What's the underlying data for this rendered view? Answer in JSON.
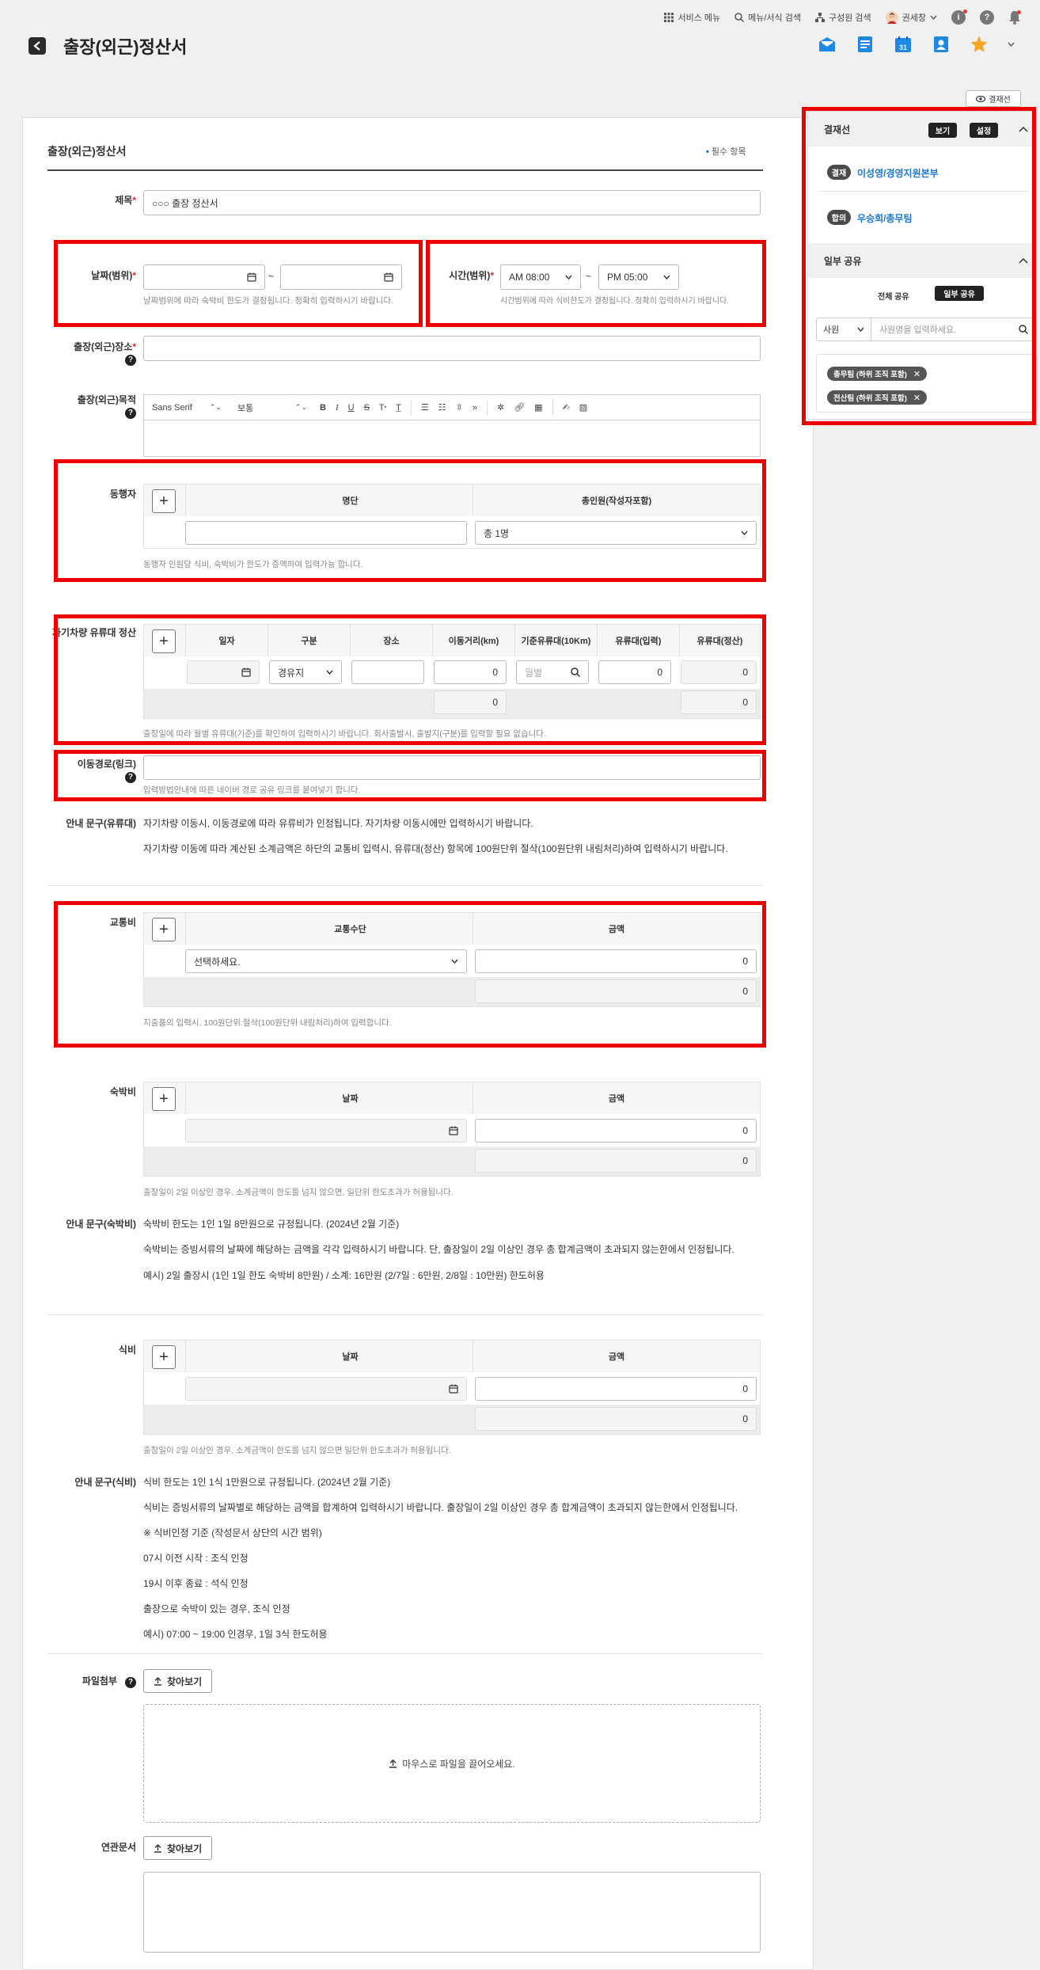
{
  "topnav": {
    "service_menu": "서비스 메뉴",
    "menu_search": "메뉴/서식 검색",
    "member_search": "구성원 검색",
    "user_name": "권세창"
  },
  "page": {
    "title": "출장(외근)정산서"
  },
  "approval_line_button": "결재선",
  "form": {
    "title": "출장(외근)정산서",
    "required_note": "필수 항목",
    "subject": {
      "label": "제목",
      "value": "○○○ 출장 정산서"
    },
    "date_range": {
      "label": "날짜(범위)",
      "separator": "~",
      "help": "날짜범위에 따라 숙박비 한도가 결정됩니다. 정확히 입력하시기 바랍니다."
    },
    "time_range": {
      "label": "시간(범위)",
      "start": "AM 08:00",
      "end": "PM 05:00",
      "separator": "~",
      "help": "시간범위에 따라 식비한도가 결정됩니다. 정확히 입력하시기 바랍니다."
    },
    "place": {
      "label": "출장(외근)장소"
    },
    "purpose": {
      "label": "출장(외근)목적",
      "toolbar_font": "Sans Serif",
      "toolbar_size": "보통"
    },
    "companions": {
      "label": "동행자",
      "col_list": "명단",
      "col_total": "총인원(작성자포함)",
      "total_value": "총 1명",
      "help": "동행자 인원당 식비, 숙박비가 한도가 증액하여 입력가능 합니다."
    },
    "car": {
      "label": "자기차량 유류대 정산",
      "columns": [
        "일자",
        "구분",
        "장소",
        "이동거리(km)",
        "기준유류대(10Km)",
        "유류대(입력)",
        "유류대(정산)"
      ],
      "fuel_type": "경유지",
      "distance": "0",
      "base_placeholder": "월별",
      "fuel_input": "0",
      "fuel_settle": "0",
      "sum_distance": "0",
      "sum_settle": "0",
      "help": "출장일에 따라 월별 유류대(기준)를 확인하여 입력하시기 바랍니다. 회사출발시, 출발지(구분)를 입력할 필요 없습니다."
    },
    "route": {
      "label": "이동경로(링크)",
      "help": "입력방법안내에 따른 네이버 경로 공유 링크를 붙여넣기 합니다."
    },
    "guide_fuel": {
      "label": "안내 문구(유류대)",
      "lines": [
        "자기차량 이동시, 이동경로에 따라 유류비가 인정됩니다. 자기차량 이동시에만 입력하시기 바랍니다.",
        "자기차량 이동에 따라 계산된 소계금액은 하단의 교통비 입력시, 유류대(정산) 항목에 100원단위 절삭(100원단위 내림처리)하여 입력하시기 바랍니다."
      ]
    },
    "transport": {
      "label": "교통비",
      "col_means": "교통수단",
      "col_amount": "금액",
      "select_placeholder": "선택하세요.",
      "amount": "0",
      "sum": "0",
      "help": "지출품의 입력시, 100원단위 절삭(100원단위 내림처리)하여 입력합니다."
    },
    "lodging": {
      "label": "숙박비",
      "col_date": "날짜",
      "col_amount": "금액",
      "amount": "0",
      "sum": "0",
      "help": "출장일이 2일 이상인 경우, 소계금액이 한도를 넘지 않으면, 일단위 한도초과가 허용됩니다."
    },
    "guide_lodging": {
      "label": "안내 문구(숙박비)",
      "lines": [
        "숙박비 한도는 1인 1일 8만원으로 규정됩니다. (2024년 2월 기준)",
        "숙박비는 증빙서류의 날짜에 해당하는 금액을 각각 입력하시기 바랍니다. 단, 출장일이 2일 이상인 경우 총 합계금액이 초과되지 않는한에서 인정됩니다.",
        "예시) 2일 출장시 (1인 1일 한도 숙박비 8만원) / 소계: 16만원 (2/7일 : 6만원, 2/8일 : 10만원) 한도허용"
      ]
    },
    "meal": {
      "label": "식비",
      "col_date": "날짜",
      "col_amount": "금액",
      "amount": "0",
      "sum": "0",
      "help": "출장일이 2일 이상인 경우, 소계금액이 한도를 넘지 않으면 일단위 한도초과가 허용됩니다."
    },
    "guide_meal": {
      "label": "안내 문구(식비)",
      "lines": [
        "식비 한도는 1인 1식 1만원으로 규정됩니다. (2024년 2월 기준)",
        "식비는 증빙서류의 날짜별로 해당하는 금액을 합계하여 입력하시기 바랍니다. 출장일이 2일 이상인 경우 총 합계금액이 초과되지 않는한에서 인정됩니다.",
        "※ 식비인정 기준 (작성문서 상단의 시간 범위)",
        "07시 이전 시작 : 조식 인정",
        "19시 이후 종료 : 석식 인정",
        "출장으로 숙박이 있는 경우, 조식 인정",
        "예시) 07:00 ~ 19:00 인경우, 1일 3식 한도허용"
      ]
    },
    "attach": {
      "label": "파일첨부",
      "button": "찾아보기",
      "drop_text": "마우스로 파일을 끌어오세요."
    },
    "related": {
      "label": "연관문서",
      "button": "찾아보기"
    }
  },
  "sidebar": {
    "approval": {
      "title": "결재선",
      "view_button": "보기",
      "settings_button": "설정",
      "entries": [
        {
          "type": "결재",
          "name": "이성영/경영지원본부"
        },
        {
          "type": "합의",
          "name": "우승희/총무팀"
        }
      ]
    },
    "share": {
      "title": "일부 공유",
      "tab_all": "전체 공유",
      "tab_partial": "일부 공유",
      "search_scope": "사원",
      "search_placeholder": "사원명을 입력하세요.",
      "tags": [
        "총무팀 (하위 조직 포함)",
        "전산팀 (하위 조직 포함)"
      ]
    }
  },
  "colors": {
    "accent_blue": "#1976d2",
    "annotation_red": "#ee0000",
    "star": "#f5a623"
  }
}
